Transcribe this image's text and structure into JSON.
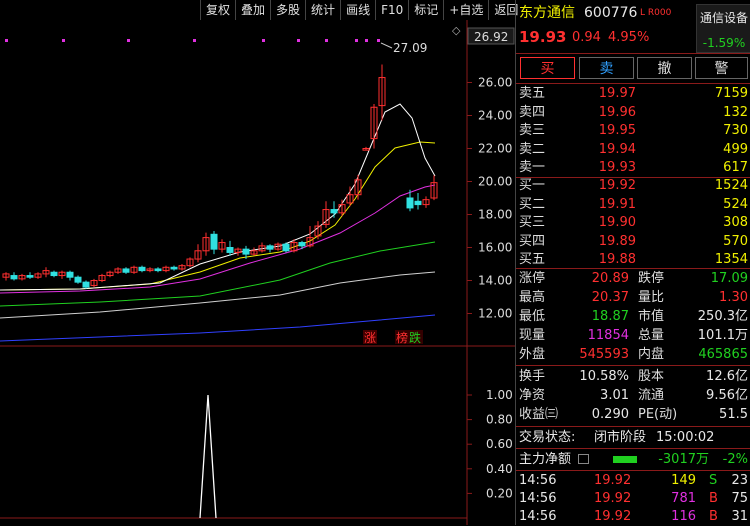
{
  "toolbar": [
    "复权",
    "叠加",
    "多股",
    "统计",
    "画线",
    "F10",
    "标记",
    "+自选",
    "返回"
  ],
  "chart": {
    "price_axis": [
      "26.00",
      "24.00",
      "22.00",
      "20.00",
      "18.00",
      "16.00",
      "14.00",
      "12.00"
    ],
    "price_axis_top": "26.92",
    "peak_label": "27.09",
    "volume_axis": [
      "1.00",
      "0.80",
      "0.60",
      "0.40",
      "0.20"
    ],
    "tag_zhang": "涨",
    "tag_bang": "榜",
    "tag_die": "跌",
    "diamond": "◇",
    "colors": {
      "up": "#ff3030",
      "down": "#30e0e0",
      "ma1": "#ffffff",
      "ma2": "#f0f000",
      "ma3": "#e030e0",
      "ma4": "#20d020",
      "ma5": "#d0d0d0",
      "ma6": "#3040ff"
    }
  },
  "stock": {
    "name": "东方通信",
    "code": "600776",
    "flags": "L R000",
    "price": "19.93",
    "change": "0.94",
    "change_pct": "4.95%",
    "industry": "通信设备",
    "industry_pct": "-1.59%"
  },
  "actions": {
    "buy": "买",
    "sell": "卖",
    "cancel": "撤",
    "alert": "警"
  },
  "sell_orders": [
    {
      "label": "卖五",
      "price": "19.97",
      "vol": "7159"
    },
    {
      "label": "卖四",
      "price": "19.96",
      "vol": "132"
    },
    {
      "label": "卖三",
      "price": "19.95",
      "vol": "730"
    },
    {
      "label": "卖二",
      "price": "19.94",
      "vol": "499"
    },
    {
      "label": "卖一",
      "price": "19.93",
      "vol": "617"
    }
  ],
  "buy_orders": [
    {
      "label": "买一",
      "price": "19.92",
      "vol": "1524"
    },
    {
      "label": "买二",
      "price": "19.91",
      "vol": "524"
    },
    {
      "label": "买三",
      "price": "19.90",
      "vol": "308"
    },
    {
      "label": "买四",
      "price": "19.89",
      "vol": "570"
    },
    {
      "label": "买五",
      "price": "19.88",
      "vol": "1354"
    }
  ],
  "quotes": {
    "zhangting_l": "涨停",
    "zhangting": "20.89",
    "dieting_l": "跌停",
    "dieting": "17.09",
    "high_l": "最高",
    "high": "20.37",
    "liangbi_l": "量比",
    "liangbi": "1.30",
    "low_l": "最低",
    "low": "18.87",
    "shizhi_l": "市值",
    "shizhi": "250.3亿",
    "xianliang_l": "现量",
    "xianliang": "11854",
    "zongliang_l": "总量",
    "zongliang": "101.1万",
    "waipan_l": "外盘",
    "waipan": "545593",
    "neipan_l": "内盘",
    "neipan": "465865",
    "huanshou_l": "换手",
    "huanshou": "10.58%",
    "guben_l": "股本",
    "guben": "12.6亿",
    "jingzi_l": "净资",
    "jingzi": "3.01",
    "liutong_l": "流通",
    "liutong": "9.56亿",
    "shouyi_l": "收益㈢",
    "shouyi": "0.290",
    "pe_l": "PE(动)",
    "pe": "51.5"
  },
  "status": {
    "label": "交易状态:",
    "state": "闭市阶段",
    "time": "15:00:02"
  },
  "flow": {
    "label": "主力净额",
    "value": "-3017万",
    "pct": "-2%"
  },
  "ticks": [
    {
      "time": "14:56",
      "price": "19.92",
      "vol": "149",
      "side": "S",
      "n": "23"
    },
    {
      "time": "14:56",
      "price": "19.92",
      "vol": "781",
      "side": "B",
      "n": "75"
    },
    {
      "time": "14:56",
      "price": "19.92",
      "vol": "116",
      "side": "B",
      "n": "31"
    }
  ]
}
